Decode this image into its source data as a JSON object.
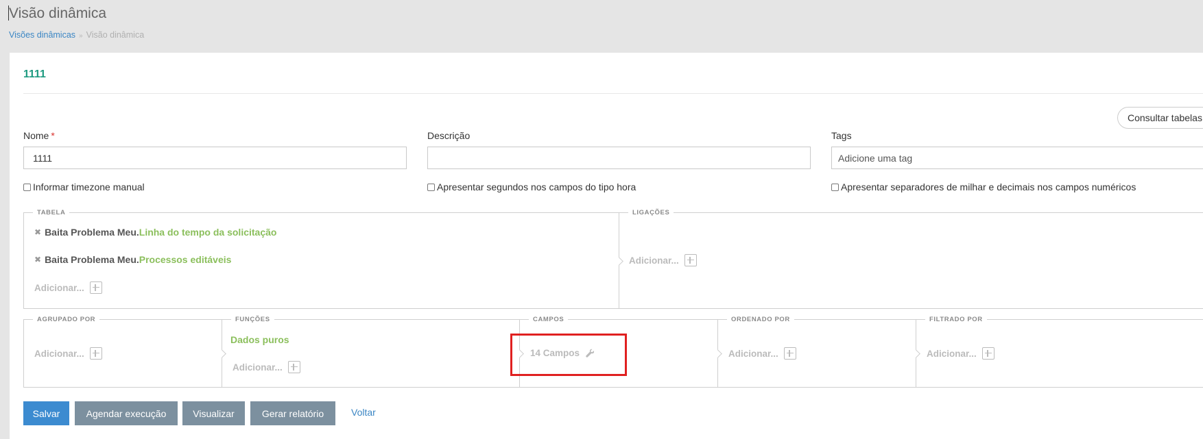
{
  "page": {
    "title": "Visão dinâmica",
    "breadcrumb": {
      "parent": "Visões dinâmicas",
      "separator": "»",
      "current": "Visão dinâmica"
    },
    "record_title": "1111"
  },
  "header_actions": {
    "consult_tables_label": "Consultar tabelas"
  },
  "form": {
    "name_label": "Nome",
    "required_mark": "*",
    "name_value": "1111",
    "description_label": "Descrição",
    "description_value": "",
    "tags_label": "Tags",
    "tags_placeholder": "Adicione uma tag",
    "checkbox_timezone": {
      "label": "Informar timezone manual",
      "checked": false
    },
    "checkbox_seconds": {
      "label": "Apresentar segundos nos campos do tipo hora",
      "checked": false
    },
    "checkbox_separators": {
      "label": "Apresentar separadores de milhar e decimais nos campos numéricos",
      "checked": false
    }
  },
  "builder": {
    "table_legend": "TABELA",
    "tables": [
      {
        "prefix": "Baita Problema Meu.",
        "name": "Linha do tempo da solicitação"
      },
      {
        "prefix": "Baita Problema Meu.",
        "name": "Processos editáveis"
      }
    ],
    "links_legend": "LIGAÇÕES",
    "grouped_legend": "AGRUPADO POR",
    "functions_legend": "FUNÇÕES",
    "functions_value": "Dados puros",
    "fields_legend": "CAMPOS",
    "fields_value": "14 Campos",
    "ordered_legend": "ORDENADO POR",
    "filtered_legend": "FILTRADO POR",
    "add_label": "Adicionar..."
  },
  "actions": {
    "save": "Salvar",
    "schedule": "Agendar execução",
    "view": "Visualizar",
    "report": "Gerar relatório",
    "back": "Voltar"
  },
  "colors": {
    "accent_green": "#8bbf5c",
    "title_teal": "#1d9a80",
    "primary_blue": "#3c8bd0",
    "secondary_gray": "#7c909f",
    "highlight_red": "#e02020"
  }
}
